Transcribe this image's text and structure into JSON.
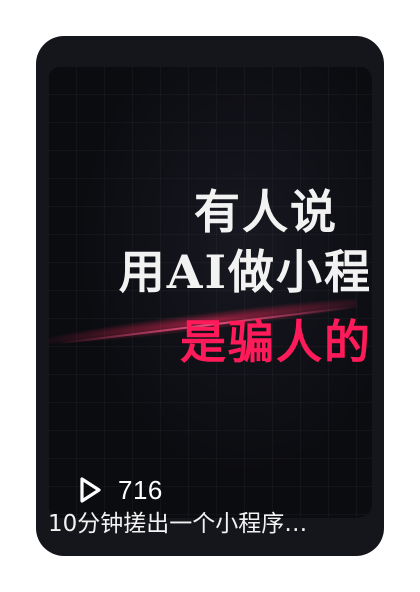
{
  "card": {
    "thumbnail": {
      "headline_line1": "有人说",
      "headline_line2": "用AI做小程",
      "headline_line3": "是骗人的",
      "highlight_color": "#ff1a5a"
    },
    "stats": {
      "play_icon": "play-icon",
      "views": "716"
    },
    "title": "10分钟搓出一个小程序…"
  }
}
